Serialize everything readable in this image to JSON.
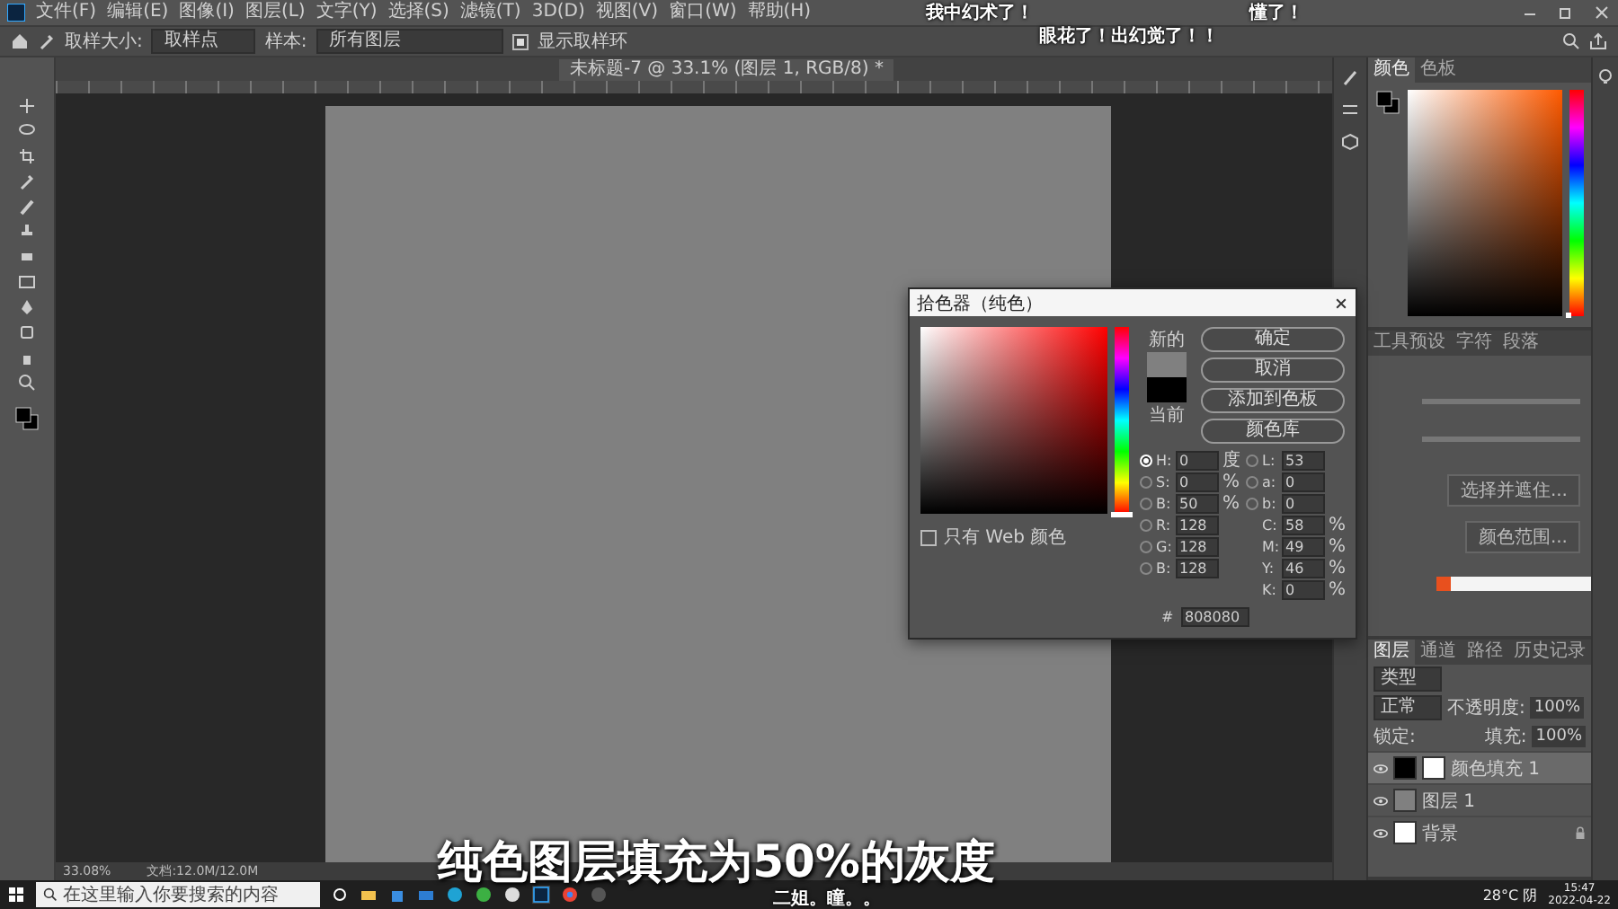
{
  "menu_bar": {
    "items": [
      "文件(F)",
      "编辑(E)",
      "图像(I)",
      "图层(L)",
      "文字(Y)",
      "选择(S)",
      "滤镜(T)",
      "3D(D)",
      "视图(V)",
      "窗口(W)",
      "帮助(H)"
    ]
  },
  "danmaku": [
    {
      "text": "我中幻术了！"
    },
    {
      "text": "懂了！"
    },
    {
      "text": "眼花了！出幻觉了！！"
    },
    {
      "text": "二姐。瞳。。"
    }
  ],
  "options_bar": {
    "sample_size_label": "取样大小:",
    "sample_size": "取样点",
    "sample_label": "样本:",
    "sample": "所有图层",
    "show_ring": {
      "label": "显示取样环",
      "checked": true
    }
  },
  "document_tab": {
    "title": "未标题-7 @ 33.1% (图层 1, RGB/8) *"
  },
  "status_bar": {
    "zoom": "33.08%",
    "document": "文档:12.0M/12.0M"
  },
  "color_panel": {
    "tabs": [
      {
        "label": "颜色",
        "selected": true
      },
      {
        "label": "色板",
        "selected": false
      }
    ],
    "hue_slider": {
      "level": 0
    }
  },
  "properties_panel": {
    "tabs": [
      {
        "label": "工具预设",
        "selected": false
      },
      {
        "label": "字符",
        "selected": false
      },
      {
        "label": "段落",
        "selected": false
      }
    ],
    "buttons": [
      "选择并遮住...",
      "颜色范围..."
    ]
  },
  "layers_panel": {
    "tabs": [
      {
        "label": "图层",
        "selected": true
      },
      {
        "label": "通道",
        "selected": false
      },
      {
        "label": "路径",
        "selected": false
      },
      {
        "label": "历史记录",
        "selected": false
      }
    ],
    "filter_placeholder": "类型",
    "blend_mode": "正常",
    "opacity_label": "不透明度:",
    "opacity": "100%",
    "lock_label": "锁定:",
    "fill_label": "填充:",
    "fill": "100%",
    "layers": [
      {
        "name": "颜色填充 1",
        "kind": "fill",
        "selected": true,
        "visible": true,
        "locked": false
      },
      {
        "name": "图层 1",
        "kind": "pixel",
        "selected": false,
        "visible": true,
        "locked": false
      },
      {
        "name": "背景",
        "kind": "background",
        "selected": false,
        "visible": true,
        "locked": true
      }
    ]
  },
  "color_picker": {
    "title": "拾色器（纯色）",
    "buttons": [
      "确定",
      "取消",
      "添加到色板",
      "颜色库"
    ],
    "new_label": "新的",
    "current_label": "当前",
    "hue_slider": {
      "level": 0
    },
    "web_only": {
      "label": "只有 Web 颜色",
      "checked": false
    },
    "left_fields": [
      {
        "kind": "radio",
        "label": "H:",
        "value": "0",
        "unit": "度",
        "selected": true
      },
      {
        "kind": "radio",
        "label": "S:",
        "value": "0",
        "unit": "%",
        "selected": false
      },
      {
        "kind": "radio",
        "label": "B:",
        "value": "50",
        "unit": "%",
        "selected": false
      },
      {
        "kind": "radio",
        "label": "R:",
        "value": "128",
        "selected": false
      },
      {
        "kind": "radio",
        "label": "G:",
        "value": "128",
        "selected": false
      },
      {
        "kind": "radio",
        "label": "B:",
        "value": "128",
        "selected": false
      }
    ],
    "right_fields": [
      {
        "kind": "radio",
        "label": "L:",
        "value": "53",
        "selected": false
      },
      {
        "kind": "radio",
        "label": "a:",
        "value": "0",
        "selected": false
      },
      {
        "kind": "radio",
        "label": "b:",
        "value": "0",
        "selected": false
      },
      {
        "kind": "plain",
        "label": "C:",
        "value": "58",
        "unit": "%"
      },
      {
        "kind": "plain",
        "label": "M:",
        "value": "49",
        "unit": "%"
      },
      {
        "kind": "plain",
        "label": "Y:",
        "value": "46",
        "unit": "%"
      },
      {
        "kind": "plain",
        "label": "K:",
        "value": "0",
        "unit": "%"
      }
    ],
    "hex_label": "#",
    "hex": "808080"
  },
  "subtitle": "纯色图层填充为50%的灰度",
  "taskbar": {
    "search_placeholder": "在这里输入你要搜索的内容",
    "weather": "28°C 阴",
    "time": "15:47",
    "date": "2022-04-22"
  }
}
